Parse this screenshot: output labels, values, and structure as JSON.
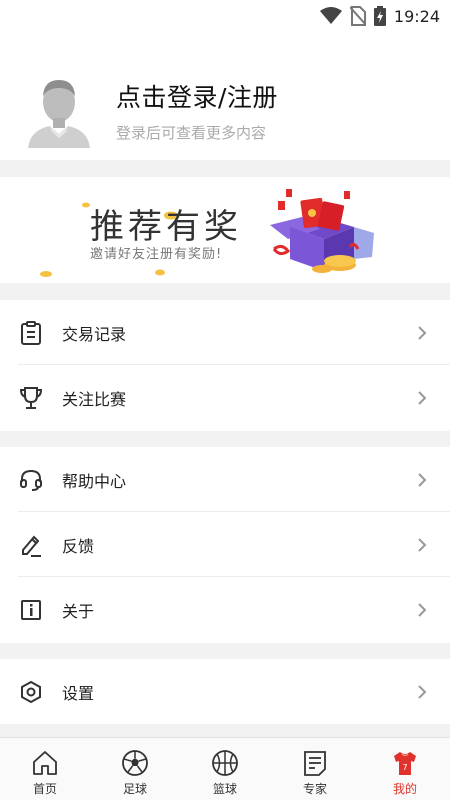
{
  "status_bar": {
    "time": "19:24"
  },
  "profile": {
    "title": "点击登录/注册",
    "subtitle": "登录后可查看更多内容"
  },
  "banner": {
    "title": "推荐有奖",
    "subtitle": "邀请好友注册有奖励!"
  },
  "menu_groups": [
    [
      {
        "label": "交易记录",
        "icon": "clipboard-icon"
      },
      {
        "label": "关注比赛",
        "icon": "trophy-icon"
      }
    ],
    [
      {
        "label": "帮助中心",
        "icon": "headset-icon"
      },
      {
        "label": "反馈",
        "icon": "pencil-icon"
      },
      {
        "label": "关于",
        "icon": "info-icon"
      }
    ],
    [
      {
        "label": "设置",
        "icon": "settings-hexagon-icon"
      }
    ]
  ],
  "tabs": [
    {
      "label": "首页",
      "icon": "home-icon",
      "active": false
    },
    {
      "label": "足球",
      "icon": "soccer-ball-icon",
      "active": false
    },
    {
      "label": "篮球",
      "icon": "basketball-icon",
      "active": false
    },
    {
      "label": "专家",
      "icon": "expert-document-icon",
      "active": false
    },
    {
      "label": "我的",
      "icon": "jersey-icon",
      "active": true
    }
  ],
  "colors": {
    "accent": "#e0322c",
    "background": "#f2f2f2"
  }
}
